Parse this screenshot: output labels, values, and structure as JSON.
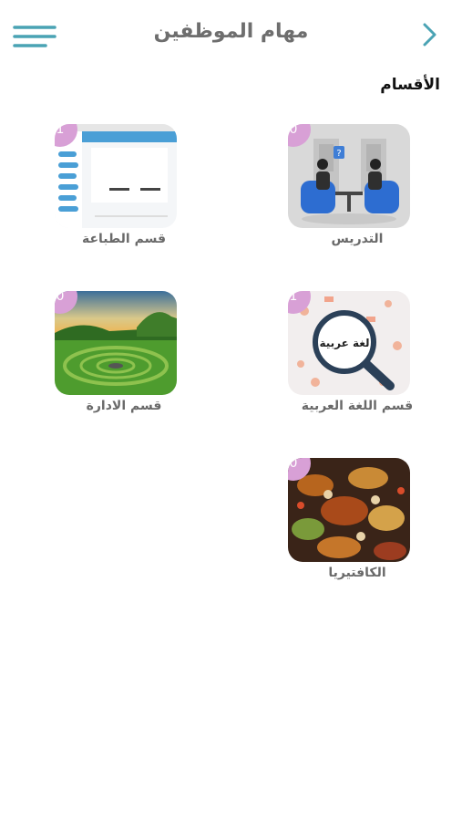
{
  "header": {
    "title": "مهام الموظفين"
  },
  "section": {
    "title": "الأقسام"
  },
  "tiles": [
    {
      "name": "التدريس",
      "count": "0",
      "image": "teaching-illustration"
    },
    {
      "name": "قسم الطباعة",
      "count": "1",
      "image": "app-screenshot"
    },
    {
      "name": "قسم اللغة العربية",
      "count": "1",
      "image": "arabic-magnifier"
    },
    {
      "name": "قسم الادارة",
      "count": "0",
      "image": "green-landscape"
    },
    {
      "name": "الكافتيريا",
      "count": "0",
      "image": "food-spread"
    }
  ],
  "thumb_text": {
    "magnifier": "لغة عربية"
  },
  "colors": {
    "accent": "#4aa3b4",
    "badge": "#d8a0d6",
    "title": "#6e6e6e"
  }
}
